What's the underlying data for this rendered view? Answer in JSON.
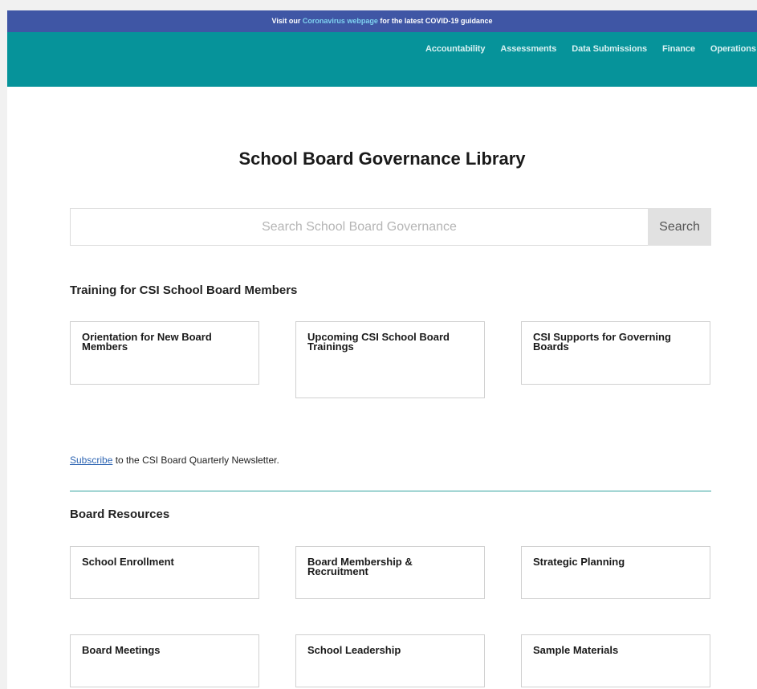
{
  "covid_banner": {
    "prefix": "Visit our ",
    "link": "Coronavirus webpage",
    "suffix": " for the latest COVID-19 guidance"
  },
  "nav": {
    "items": [
      "Accountability",
      "Assessments",
      "Data Submissions",
      "Finance",
      "Operations"
    ]
  },
  "page_title": "School Board Governance Library",
  "search": {
    "placeholder": "Search School Board Governance",
    "value": "",
    "button_label": "Search"
  },
  "training": {
    "heading": "Training for CSI School Board Members",
    "cards": [
      "Orientation for New Board Members",
      "Upcoming CSI School Board Trainings",
      "CSI Supports for Governing Boards"
    ]
  },
  "subscribe": {
    "link": "Subscribe",
    "text": " to the CSI Board Quarterly Newsletter."
  },
  "resources": {
    "heading": "Board Resources",
    "cards": [
      "School Enrollment",
      "Board Membership & Recruitment",
      "Strategic Planning",
      "Board Meetings",
      "School Leadership",
      "Sample Materials"
    ]
  },
  "colors": {
    "banner": "#3f56a5",
    "nav": "#06939a",
    "divider": "#32a39f",
    "link": "#2f66b3"
  }
}
